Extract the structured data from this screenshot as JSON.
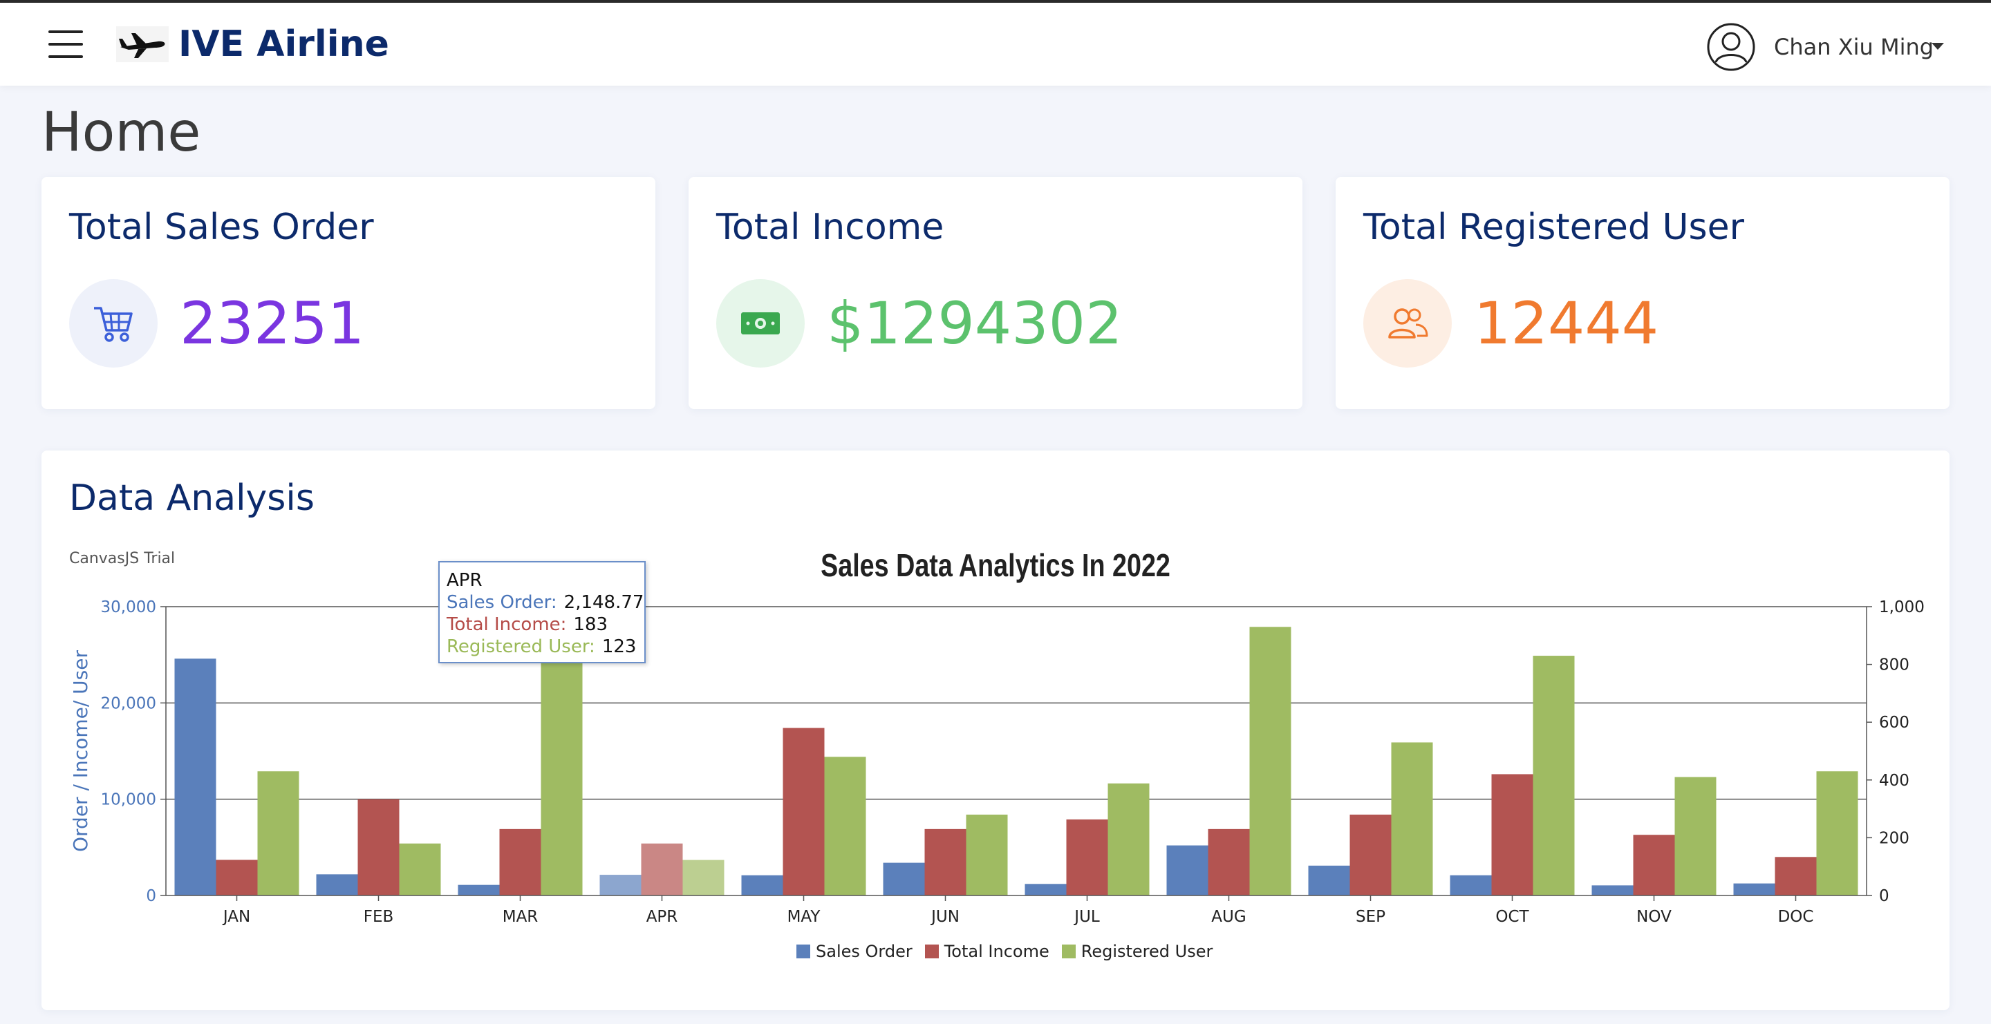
{
  "navbar": {
    "brand_name": "IVE Airline",
    "user_name": "Chan Xiu Ming"
  },
  "page_title": "Home",
  "cards": [
    {
      "title": "Total Sales Order",
      "value": "23251",
      "icon": "shopping-cart-icon",
      "color": "#7a35e0",
      "icon_bg": "#eef1fa",
      "icon_color": "#3b5fd9"
    },
    {
      "title": "Total Income",
      "value": "$1294302",
      "icon": "cash-icon",
      "color": "#5cc26d",
      "icon_bg": "#e6f6ea",
      "icon_color": "#3aa84f"
    },
    {
      "title": "Total Registered User",
      "value": "12444",
      "icon": "users-icon",
      "color": "#f07a2f",
      "icon_bg": "#fdeee3",
      "icon_color": "#f07a2f"
    }
  ],
  "panel": {
    "title": "Data Analysis",
    "trial_label": "CanvasJS Trial"
  },
  "chart_data": {
    "type": "bar",
    "title": "Sales Data Analytics In 2022",
    "ylabel": "Order / Income/ User",
    "categories": [
      "JAN",
      "FEB",
      "MAR",
      "APR",
      "MAY",
      "JUN",
      "JUL",
      "AUG",
      "SEP",
      "OCT",
      "NOV",
      "DOC"
    ],
    "ylim": [
      0,
      30000
    ],
    "y2lim": [
      0,
      1000
    ],
    "yticks": [
      0,
      10000,
      20000,
      30000
    ],
    "ytick_labels": [
      "0",
      "10,000",
      "20,000",
      "30,000"
    ],
    "y2ticks": [
      0,
      200,
      400,
      600,
      800,
      1000
    ],
    "y2tick_labels": [
      "0",
      "200",
      "400",
      "600",
      "800",
      "1,000"
    ],
    "grid": true,
    "legend_position": "bottom",
    "highlight_index": 3,
    "series": [
      {
        "name": "Sales Order",
        "axis": "left",
        "color": "#5b80bb",
        "values": [
          24600,
          2200,
          1100,
          2148.77,
          2100,
          3400,
          1200,
          5200,
          3100,
          2100,
          1050,
          1250
        ]
      },
      {
        "name": "Total Income",
        "axis": "left",
        "color": "#b35451",
        "values": [
          3700,
          10000,
          6900,
          5400,
          17400,
          6900,
          7900,
          6900,
          8400,
          12600,
          6300,
          4000
        ]
      },
      {
        "name": "Registered User",
        "axis": "right",
        "color": "#9fbb62",
        "values": [
          430,
          180,
          830,
          123,
          480,
          280,
          388,
          930,
          530,
          830,
          410,
          430
        ]
      }
    ]
  },
  "tooltip": {
    "title": "APR",
    "rows": [
      {
        "label": "Sales Order:",
        "value": "2,148.77",
        "color": "#4a75b9"
      },
      {
        "label": "Total Income:",
        "value": "183",
        "color": "#b54c48"
      },
      {
        "label": "Registered User:",
        "value": "123",
        "color": "#9ab957"
      }
    ]
  }
}
